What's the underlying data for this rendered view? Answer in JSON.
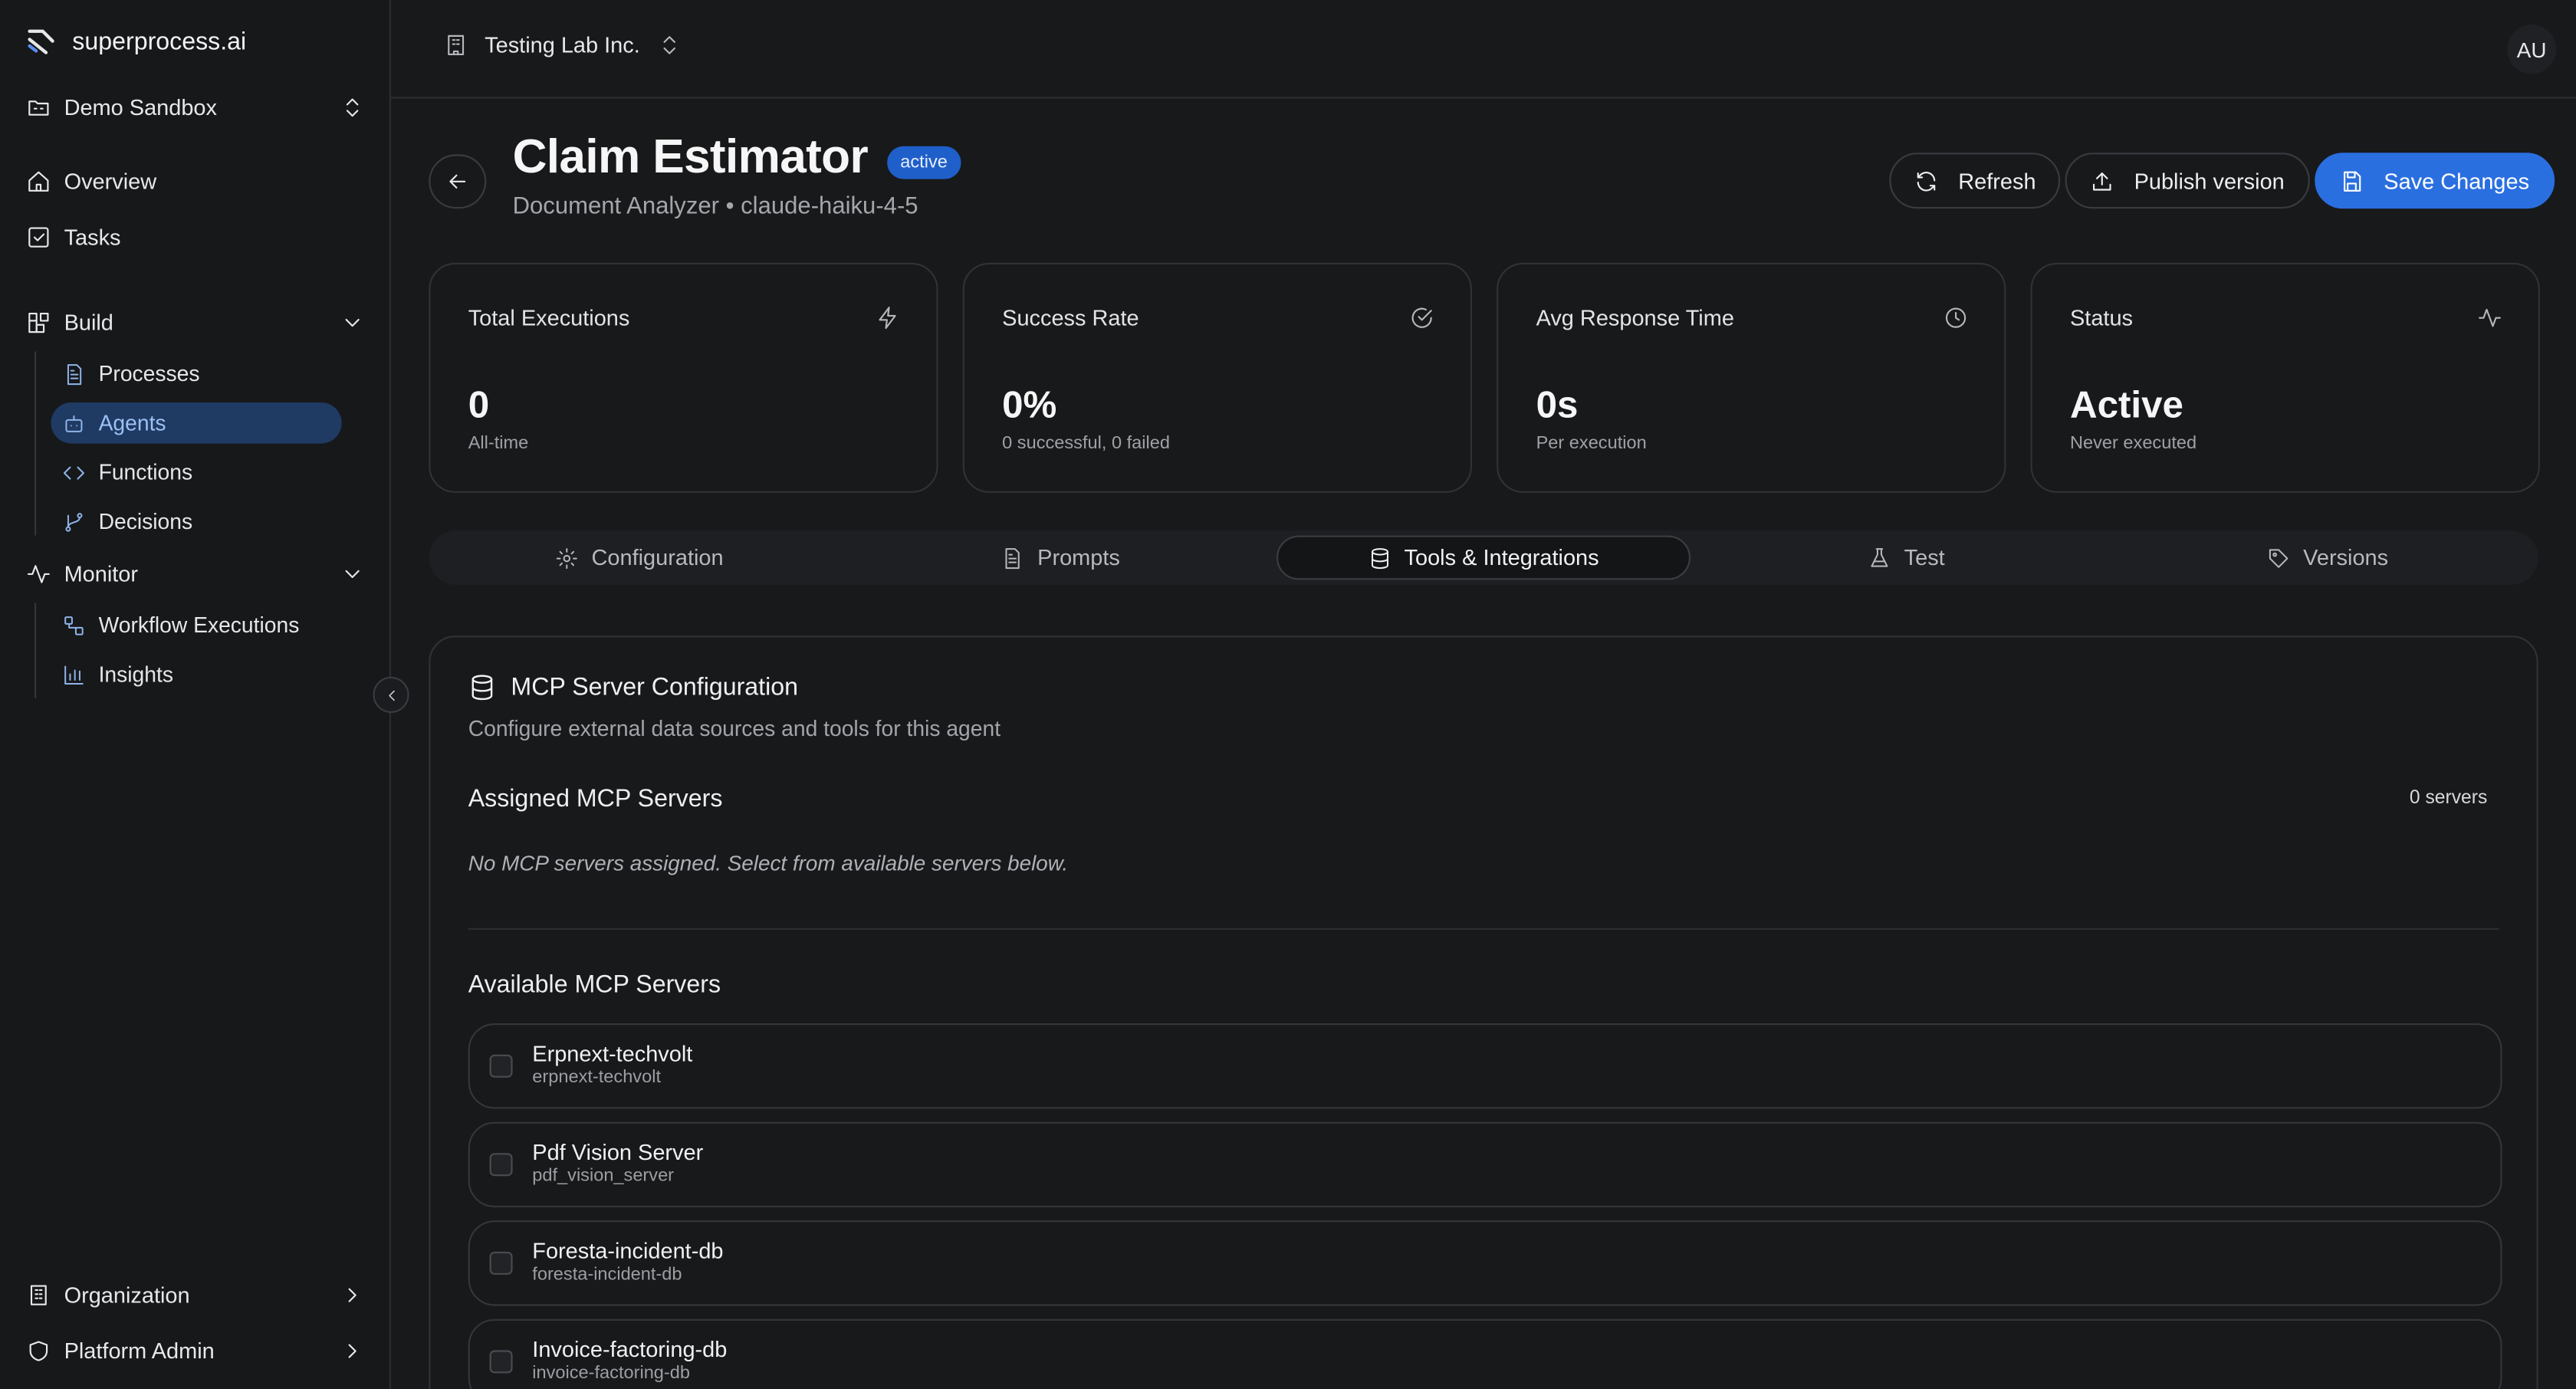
{
  "brand": {
    "name": "superprocess.ai"
  },
  "workspace": {
    "name": "Demo Sandbox"
  },
  "sidebar": {
    "overview": "Overview",
    "tasks": "Tasks",
    "build": {
      "label": "Build",
      "items": [
        {
          "label": "Processes",
          "icon": "file-text-icon"
        },
        {
          "label": "Agents",
          "icon": "bot-icon",
          "active": true
        },
        {
          "label": "Functions",
          "icon": "code-icon"
        },
        {
          "label": "Decisions",
          "icon": "git-branch-icon"
        }
      ]
    },
    "monitor": {
      "label": "Monitor",
      "items": [
        {
          "label": "Workflow Executions",
          "icon": "workflow-icon"
        },
        {
          "label": "Insights",
          "icon": "bar-chart-icon"
        }
      ]
    },
    "organization": "Organization",
    "platform_admin": "Platform Admin"
  },
  "topbar": {
    "org_name": "Testing Lab Inc.",
    "avatar_initials": "AU"
  },
  "header": {
    "title": "Claim Estimator",
    "status_badge": "active",
    "subtitle": "Document Analyzer • claude-haiku-4-5",
    "refresh_label": "Refresh",
    "publish_label": "Publish version",
    "save_label": "Save Changes"
  },
  "stats": [
    {
      "label": "Total Executions",
      "value": "0",
      "note": "All-time",
      "icon": "zap-icon"
    },
    {
      "label": "Success Rate",
      "value": "0%",
      "note": "0 successful, 0 failed",
      "icon": "check-circle-icon"
    },
    {
      "label": "Avg Response Time",
      "value": "0s",
      "note": "Per execution",
      "icon": "clock-icon"
    },
    {
      "label": "Status",
      "value": "Active",
      "note": "Never executed",
      "icon": "activity-icon"
    }
  ],
  "tabs": [
    {
      "label": "Configuration",
      "icon": "gear-icon"
    },
    {
      "label": "Prompts",
      "icon": "file-text-icon"
    },
    {
      "label": "Tools & Integrations",
      "icon": "database-icon",
      "active": true
    },
    {
      "label": "Test",
      "icon": "flask-icon"
    },
    {
      "label": "Versions",
      "icon": "tag-icon"
    }
  ],
  "mcp": {
    "title": "MCP Server Configuration",
    "description": "Configure external data sources and tools for this agent",
    "assigned_heading": "Assigned MCP Servers",
    "assigned_count": "0 servers",
    "assigned_empty": "No MCP servers assigned. Select from available servers below.",
    "available_heading": "Available MCP Servers",
    "servers": [
      {
        "name": "Erpnext-techvolt",
        "id": "erpnext-techvolt"
      },
      {
        "name": "Pdf Vision Server",
        "id": "pdf_vision_server"
      },
      {
        "name": "Foresta-incident-db",
        "id": "foresta-incident-db"
      },
      {
        "name": "Invoice-factoring-db",
        "id": "invoice-factoring-db"
      }
    ]
  },
  "colors": {
    "accent": "#2a6fe0",
    "badge": "#1f5fc9",
    "background": "#18191b",
    "active_nav": "#1f3a63"
  }
}
